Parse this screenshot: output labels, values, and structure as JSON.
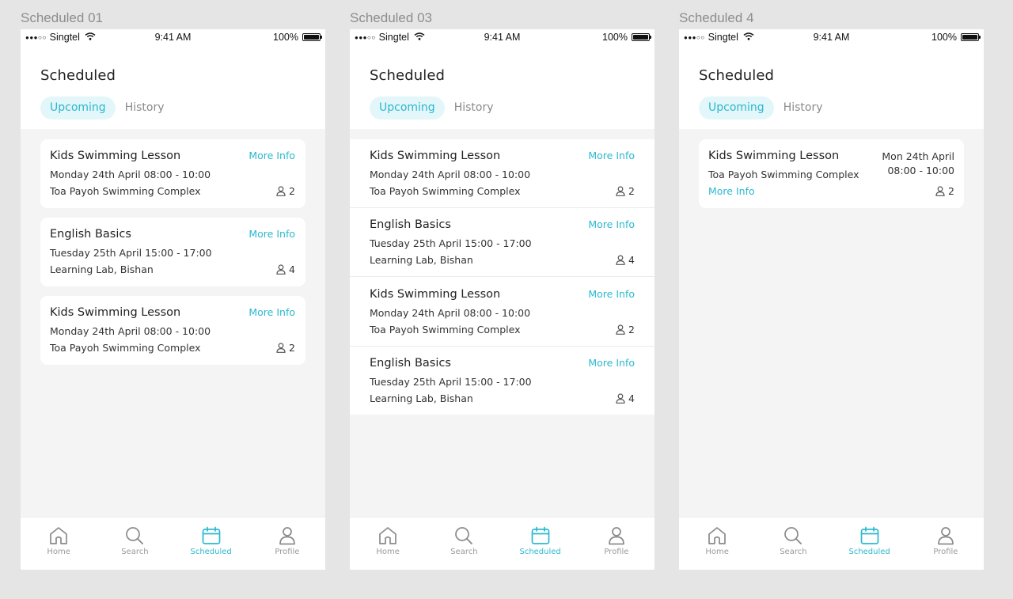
{
  "status": {
    "carrier": "Singtel",
    "time": "9:41 AM",
    "battery": "100%"
  },
  "header": {
    "title": "Scheduled",
    "tab_upcoming": "Upcoming",
    "tab_history": "History"
  },
  "nav": {
    "home": "Home",
    "search": "Search",
    "scheduled": "Scheduled",
    "profile": "Profile"
  },
  "more_info": "More Info",
  "screens": [
    {
      "label": "Scheduled 01",
      "cards": [
        {
          "title": "Kids Swimming Lesson",
          "date": "Monday 24th April  08:00 - 10:00",
          "location": "Toa Payoh Swimming Complex",
          "count": "2"
        },
        {
          "title": "English Basics",
          "date": "Tuesday 25th April  15:00 - 17:00",
          "location": "Learning Lab, Bishan",
          "count": "4"
        },
        {
          "title": "Kids Swimming Lesson",
          "date": "Monday 24th April  08:00 - 10:00",
          "location": "Toa Payoh Swimming Complex",
          "count": "2"
        }
      ]
    },
    {
      "label": "Scheduled 03",
      "cards": [
        {
          "title": "Kids Swimming Lesson",
          "date": "Monday 24th April  08:00 - 10:00",
          "location": "Toa Payoh Swimming Complex",
          "count": "2"
        },
        {
          "title": "English Basics",
          "date": "Tuesday 25th April  15:00 - 17:00",
          "location": "Learning Lab, Bishan",
          "count": "4"
        },
        {
          "title": "Kids Swimming Lesson",
          "date": "Monday 24th April  08:00 - 10:00",
          "location": "Toa Payoh Swimming Complex",
          "count": "2"
        },
        {
          "title": "English Basics",
          "date": "Tuesday 25th April  15:00 - 17:00",
          "location": "Learning Lab, Bishan",
          "count": "4"
        }
      ]
    },
    {
      "label": "Scheduled 4",
      "cards": [
        {
          "title": "Kids Swimming Lesson",
          "location": "Toa Payoh Swimming Complex",
          "date_short": "Mon 24th April",
          "time": "08:00 - 10:00",
          "count": "2"
        }
      ]
    }
  ],
  "colors": {
    "accent": "#2bb9cf",
    "accent_bg": "#e3f6f9",
    "content_bg": "#f4f4f4",
    "canvas_bg": "#e5e5e5"
  },
  "icons": [
    "signal-icon",
    "wifi-icon",
    "battery-icon",
    "person-icon",
    "home-icon",
    "search-icon",
    "calendar-icon",
    "profile-icon"
  ]
}
